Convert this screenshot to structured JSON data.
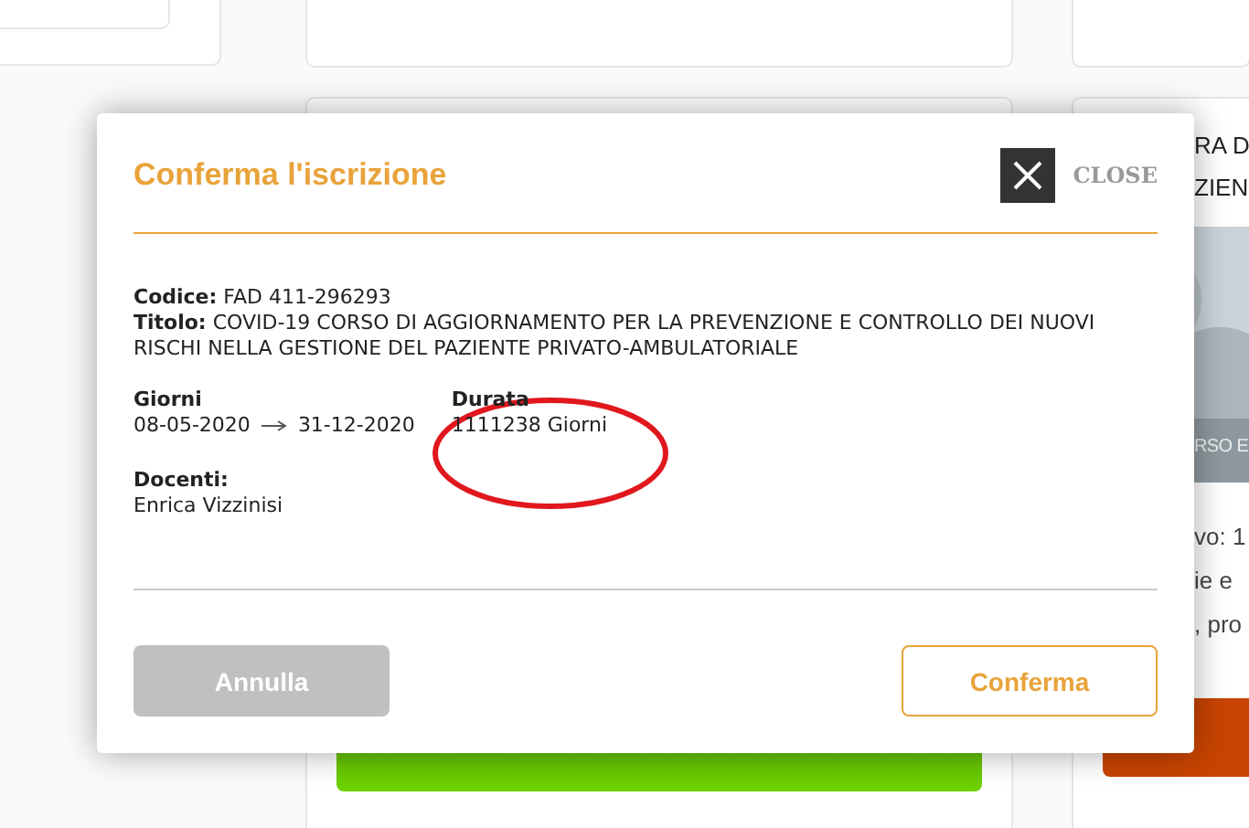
{
  "background": {
    "right_card": {
      "title_lines": [
        "RA D",
        "ZIEN"
      ],
      "picture_caption": "RSO E",
      "text_lines": [
        "vo: 1",
        "ie e",
        ", pro"
      ]
    }
  },
  "modal": {
    "title": "Conferma l'iscrizione",
    "close_label": "CLOSE",
    "code": {
      "label": "Codice:",
      "value": "FAD 411-296293"
    },
    "title_field": {
      "label": "Titolo:",
      "value": "COVID-19 CORSO DI AGGIORNAMENTO PER LA PREVENZIONE E CONTROLLO DEI NUOVI RISCHI NELLA GESTIONE DEL PAZIENTE PRIVATO-AMBULATORIALE"
    },
    "days": {
      "label": "Giorni",
      "start": "08-05-2020",
      "end": "31-12-2020"
    },
    "duration": {
      "label": "Durata",
      "value": "1111238 Giorni",
      "circled": true
    },
    "teachers": {
      "label": "Docenti:",
      "value": "Enrica Vizzinisi"
    },
    "buttons": [
      {
        "label": "Annulla",
        "kind": "secondary"
      },
      {
        "label": "Conferma",
        "kind": "primary"
      }
    ]
  }
}
